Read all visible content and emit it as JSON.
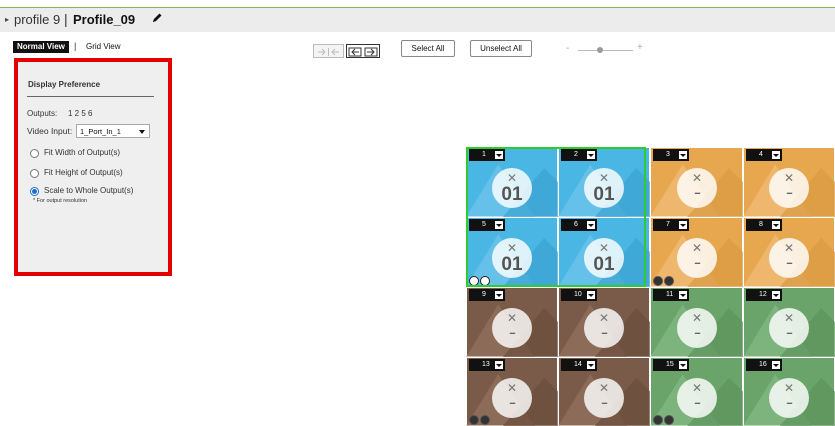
{
  "header": {
    "profile_label": "profile 9",
    "separator": "|",
    "profile_name": "Profile_09"
  },
  "view_toggle": {
    "normal": "Normal View",
    "divider": "|",
    "grid": "Grid View"
  },
  "toolbar": {
    "select_all": "Select All",
    "unselect_all": "Unselect All",
    "zoom_minus": "-",
    "zoom_plus": "+"
  },
  "panel": {
    "title": "Display Preference",
    "outputs_label": "Outputs:",
    "outputs_value": "1 2 5 6",
    "video_input_label": "Video Input:",
    "video_input_value": "1_Port_In_1",
    "options": [
      "Fit Width of Output(s)",
      "Fit Height of Output(s)",
      "Scale to Whole Output(s)"
    ],
    "selected_option": "Scale to Whole Output(s)",
    "note": "* For output resolution"
  },
  "wall": {
    "tiles": [
      {
        "num": "1",
        "label": "01",
        "color": "#4ab6e3"
      },
      {
        "num": "2",
        "label": "01",
        "color": "#4ab6e3"
      },
      {
        "num": "3",
        "label": "--",
        "color": "#e6a74f"
      },
      {
        "num": "4",
        "label": "--",
        "color": "#e6a74f"
      },
      {
        "num": "5",
        "label": "01",
        "color": "#4ab6e3"
      },
      {
        "num": "6",
        "label": "01",
        "color": "#4ab6e3"
      },
      {
        "num": "7",
        "label": "--",
        "color": "#e6a74f"
      },
      {
        "num": "8",
        "label": "--",
        "color": "#e6a74f"
      },
      {
        "num": "9",
        "label": "--",
        "color": "#7a5a48"
      },
      {
        "num": "10",
        "label": "--",
        "color": "#7a5a48"
      },
      {
        "num": "11",
        "label": "--",
        "color": "#6aa46a"
      },
      {
        "num": "12",
        "label": "--",
        "color": "#6aa46a"
      },
      {
        "num": "13",
        "label": "--",
        "color": "#7a5a48"
      },
      {
        "num": "14",
        "label": "--",
        "color": "#7a5a48"
      },
      {
        "num": "15",
        "label": "--",
        "color": "#6aa46a"
      },
      {
        "num": "16",
        "label": "--",
        "color": "#6aa46a"
      }
    ]
  }
}
